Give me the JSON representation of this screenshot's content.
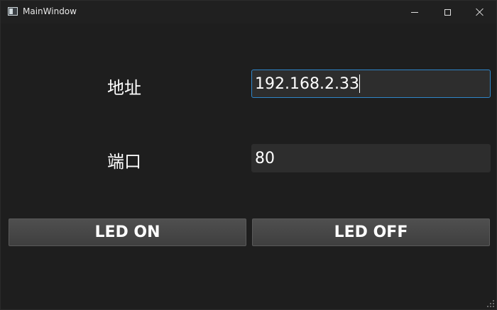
{
  "window": {
    "title": "MainWindow",
    "icons": {
      "app": "app-window-icon",
      "minimize": "minimize-icon",
      "maximize": "maximize-icon",
      "close": "close-icon"
    }
  },
  "form": {
    "address_label": "地址",
    "address_value": "192.168.2.33",
    "port_label": "端口",
    "port_value": "80"
  },
  "buttons": {
    "led_on": "LED ON",
    "led_off": "LED OFF"
  },
  "colors": {
    "background": "#1e1e1e",
    "field_background": "#2d2d2d",
    "focus_border": "#2f86c9",
    "button_background": "#484848"
  }
}
